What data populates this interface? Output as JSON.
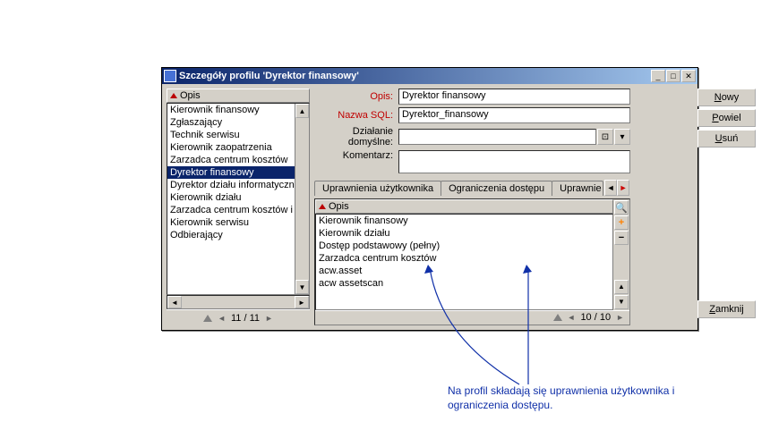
{
  "window": {
    "title": "Szczegóły profilu 'Dyrektor finansowy'"
  },
  "leftlist": {
    "header": "Opis",
    "items": [
      {
        "label": "Kierownik finansowy",
        "sel": false
      },
      {
        "label": "Zgłaszający",
        "sel": false
      },
      {
        "label": "Technik serwisu",
        "sel": false
      },
      {
        "label": "Kierownik zaopatrzenia",
        "sel": false
      },
      {
        "label": "Zarzadca centrum kosztów",
        "sel": false
      },
      {
        "label": "Dyrektor finansowy",
        "sel": true
      },
      {
        "label": "Dyrektor działu informatyczne",
        "sel": false
      },
      {
        "label": "Kierownik działu",
        "sel": false
      },
      {
        "label": "Zarzadca centrum kosztów i c",
        "sel": false
      },
      {
        "label": "Kierownik serwisu",
        "sel": false
      },
      {
        "label": "Odbierający",
        "sel": false
      }
    ],
    "counter": "11 / 11"
  },
  "fields": {
    "opis_label": "Opis:",
    "opis_value": "Dyrektor finansowy",
    "sql_label": "Nazwa SQL:",
    "sql_value": "Dyrektor_finansowy",
    "default_label": "Działanie domyślne:",
    "default_value": "",
    "comment_label": "Komentarz:"
  },
  "tabs": {
    "t1": "Uprawnienia użytkownika",
    "t2": "Ograniczenia dostępu",
    "t3": "Uprawnie"
  },
  "permlist": {
    "header": "Opis",
    "items": [
      "Kierownik finansowy",
      "Kierownik działu",
      "Dostęp podstawowy (pełny)",
      "Zarzadca centrum kosztów",
      "acw.asset",
      "acw assetscan"
    ],
    "counter": "10 / 10"
  },
  "buttons": {
    "new": "Nowy",
    "dup": "Powiel",
    "del": "Usuń",
    "close": "Zamknij"
  },
  "annotation": "Na profil składają się uprawnienia użytkownika i ograniczenia dostępu."
}
